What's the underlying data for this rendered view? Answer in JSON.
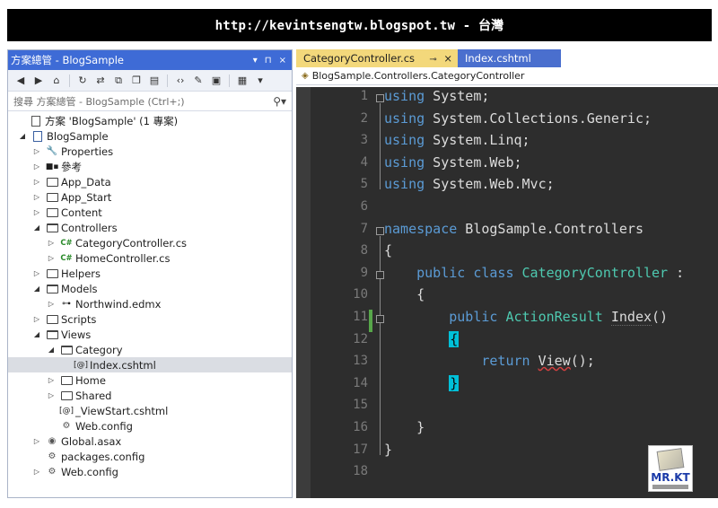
{
  "banner": {
    "text": "http://kevintsengtw.blogspot.tw - 台灣"
  },
  "solution_explorer": {
    "title": "方案總管 - BlogSample",
    "title_controls": [
      "▾",
      "⊓",
      "×"
    ],
    "search_placeholder": "搜尋 方案總管 - BlogSample (Ctrl+;)",
    "toolbar_icons": [
      "back-icon",
      "forward-icon",
      "home-icon",
      "sync-icon",
      "refresh-icon",
      "collapse-icon",
      "show-all-icon",
      "code-icon",
      "properties-icon",
      "preview-icon",
      "new-view-icon"
    ],
    "tree": [
      {
        "label": "方案 'BlogSample' (1 專案)",
        "indent": 0,
        "arrow": "",
        "icon": "solution"
      },
      {
        "label": "BlogSample",
        "indent": 0,
        "arrow": "open",
        "icon": "project"
      },
      {
        "label": "Properties",
        "indent": 1,
        "arrow": "closed",
        "icon": "wrench"
      },
      {
        "label": "參考",
        "indent": 1,
        "arrow": "closed",
        "icon": "refs"
      },
      {
        "label": "App_Data",
        "indent": 1,
        "arrow": "closed",
        "icon": "folder"
      },
      {
        "label": "App_Start",
        "indent": 1,
        "arrow": "closed",
        "icon": "folder"
      },
      {
        "label": "Content",
        "indent": 1,
        "arrow": "closed",
        "icon": "folder"
      },
      {
        "label": "Controllers",
        "indent": 1,
        "arrow": "open",
        "icon": "folder-open"
      },
      {
        "label": "CategoryController.cs",
        "indent": 2,
        "arrow": "closed",
        "icon": "cs"
      },
      {
        "label": "HomeController.cs",
        "indent": 2,
        "arrow": "closed",
        "icon": "cs"
      },
      {
        "label": "Helpers",
        "indent": 1,
        "arrow": "closed",
        "icon": "folder"
      },
      {
        "label": "Models",
        "indent": 1,
        "arrow": "open",
        "icon": "folder-open"
      },
      {
        "label": "Northwind.edmx",
        "indent": 2,
        "arrow": "closed",
        "icon": "edmx"
      },
      {
        "label": "Scripts",
        "indent": 1,
        "arrow": "closed",
        "icon": "folder"
      },
      {
        "label": "Views",
        "indent": 1,
        "arrow": "open",
        "icon": "folder-open"
      },
      {
        "label": "Category",
        "indent": 2,
        "arrow": "open",
        "icon": "folder-open"
      },
      {
        "label": "Index.cshtml",
        "indent": 3,
        "arrow": "",
        "icon": "razor",
        "selected": true
      },
      {
        "label": "Home",
        "indent": 2,
        "arrow": "closed",
        "icon": "folder"
      },
      {
        "label": "Shared",
        "indent": 2,
        "arrow": "closed",
        "icon": "folder"
      },
      {
        "label": "_ViewStart.cshtml",
        "indent": 2,
        "arrow": "",
        "icon": "razor"
      },
      {
        "label": "Web.config",
        "indent": 2,
        "arrow": "",
        "icon": "config"
      },
      {
        "label": "Global.asax",
        "indent": 1,
        "arrow": "closed",
        "icon": "asax"
      },
      {
        "label": "packages.config",
        "indent": 1,
        "arrow": "",
        "icon": "config"
      },
      {
        "label": "Web.config",
        "indent": 1,
        "arrow": "closed",
        "icon": "config"
      }
    ]
  },
  "editor": {
    "tabs": [
      {
        "label": "CategoryController.cs",
        "active": true,
        "pin": "⊸",
        "close": "×"
      },
      {
        "label": "Index.cshtml",
        "active": false
      }
    ],
    "nav_path": "BlogSample.Controllers.CategoryController",
    "code_lines": [
      {
        "n": "1",
        "parts": [
          [
            "kw",
            "using"
          ],
          [
            "",
            " System;"
          ]
        ]
      },
      {
        "n": "2",
        "parts": [
          [
            "kw",
            "using"
          ],
          [
            "",
            " System.Collections.Generic;"
          ]
        ]
      },
      {
        "n": "3",
        "parts": [
          [
            "kw",
            "using"
          ],
          [
            "",
            " System.Linq;"
          ]
        ]
      },
      {
        "n": "4",
        "parts": [
          [
            "kw",
            "using"
          ],
          [
            "",
            " System.Web;"
          ]
        ]
      },
      {
        "n": "5",
        "parts": [
          [
            "kw",
            "using"
          ],
          [
            "",
            " System.Web.Mvc;"
          ]
        ]
      },
      {
        "n": "6",
        "parts": []
      },
      {
        "n": "7",
        "parts": [
          [
            "kw",
            "namespace"
          ],
          [
            "",
            " BlogSample.Controllers"
          ]
        ]
      },
      {
        "n": "8",
        "parts": [
          [
            "",
            "{"
          ]
        ]
      },
      {
        "n": "9",
        "parts": [
          [
            "",
            "    "
          ],
          [
            "kw",
            "public"
          ],
          [
            "",
            " "
          ],
          [
            "kw",
            "class"
          ],
          [
            "",
            " "
          ],
          [
            "ty",
            "CategoryController"
          ],
          [
            "",
            " :"
          ]
        ]
      },
      {
        "n": "10",
        "parts": [
          [
            "",
            "    {"
          ]
        ]
      },
      {
        "n": "11",
        "parts": [
          [
            "",
            "        "
          ],
          [
            "kw",
            "public"
          ],
          [
            "",
            " "
          ],
          [
            "ty",
            "ActionResult"
          ],
          [
            "",
            " "
          ],
          [
            "dot",
            "Index"
          ],
          [
            "",
            "()"
          ]
        ]
      },
      {
        "n": "12",
        "parts": [
          [
            "",
            "        "
          ],
          [
            "hl",
            "{"
          ]
        ]
      },
      {
        "n": "13",
        "parts": [
          [
            "",
            "            "
          ],
          [
            "kw",
            "return"
          ],
          [
            "",
            " "
          ],
          [
            "sq",
            "View"
          ],
          [
            "",
            "();"
          ]
        ]
      },
      {
        "n": "14",
        "parts": [
          [
            "",
            "        "
          ],
          [
            "hl",
            "}"
          ]
        ]
      },
      {
        "n": "15",
        "parts": []
      },
      {
        "n": "16",
        "parts": [
          [
            "",
            "    }"
          ]
        ]
      },
      {
        "n": "17",
        "parts": [
          [
            "",
            "}"
          ]
        ]
      },
      {
        "n": "18",
        "parts": []
      }
    ]
  },
  "logo": {
    "text": "MR.KT"
  },
  "colors": {
    "banner_bg": "#000000",
    "se_title_bg": "#3e6bd6",
    "tab_active_bg": "#f3d87b",
    "tab_inactive_bg": "#4a6fce",
    "code_bg": "#2d2d2d",
    "keyword": "#5b9bd5",
    "type": "#4ec9b0",
    "brace_highlight": "#00c0d8"
  }
}
